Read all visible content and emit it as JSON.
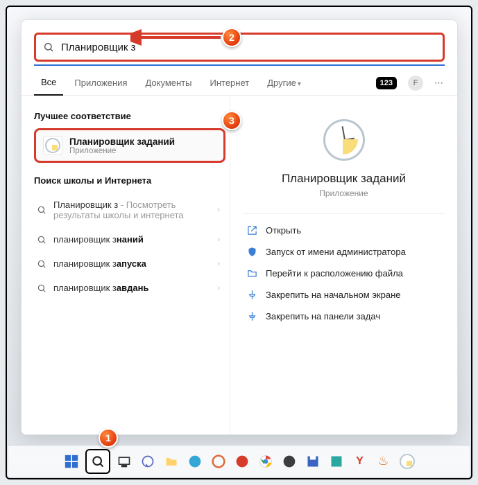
{
  "search": {
    "value": "Планировщик з"
  },
  "tabs": {
    "all": "Все",
    "apps": "Приложения",
    "docs": "Документы",
    "web": "Интернет",
    "more": "Другие"
  },
  "badge": "123",
  "avatar": "F",
  "left": {
    "best_header": "Лучшее соответствие",
    "best_title": "Планировщик заданий",
    "best_sub": "Приложение",
    "web_header": "Поиск школы и Интернета",
    "s1_prefix": "Планировщик з",
    "s1_rest": " - Посмотреть результаты школы и интернета",
    "s2_pre": "планировщик з",
    "s2_bold": "наний",
    "s3_pre": "планировщик з",
    "s3_bold": "апуска",
    "s4_pre": "планировщик з",
    "s4_bold": "авдань"
  },
  "right": {
    "title": "Планировщик заданий",
    "sub": "Приложение",
    "a1": "Открыть",
    "a2": "Запуск от имени администратора",
    "a3": "Перейти к расположению файла",
    "a4": "Закрепить на начальном экране",
    "a5": "Закрепить на панели задач"
  },
  "callouts": {
    "c1": "1",
    "c2": "2",
    "c3": "3"
  }
}
